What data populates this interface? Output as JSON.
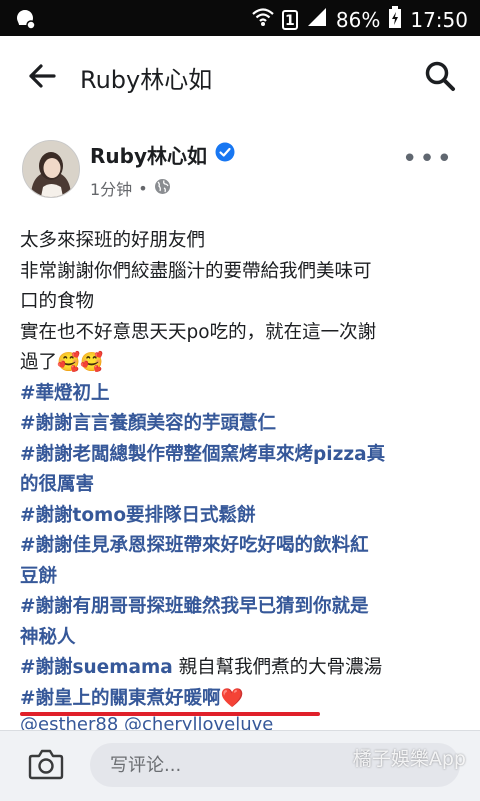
{
  "status_bar": {
    "battery": "86%",
    "time": "17:50",
    "sim_indicator": "1",
    "icons": [
      "notification-icon",
      "wifi-icon",
      "sim-icon",
      "signal-icon",
      "battery-icon"
    ]
  },
  "header": {
    "title": "Ruby林心如",
    "back_icon": "back-arrow-icon",
    "search_icon": "search-icon"
  },
  "post": {
    "author": "Ruby林心如",
    "verified_icon": "verified-badge-icon",
    "time": "1分钟",
    "separator": "•",
    "audience_icon": "globe-icon",
    "more_icon": "more-options-icon",
    "lines": [
      {
        "text": "太多來探班的好朋友們",
        "hashtag": false
      },
      {
        "text": "非常謝謝你們絞盡腦汁的要帶給我們美味可",
        "hashtag": false
      },
      {
        "text": "口的食物",
        "hashtag": false
      },
      {
        "text": "實在也不好意思天天po吃的，就在這一次謝",
        "hashtag": false
      },
      {
        "text": "過了🥰🥰",
        "hashtag": false
      },
      {
        "text": "#華燈初上",
        "hashtag": true
      },
      {
        "text": "#謝謝言言養顏美容的芋頭薏仁",
        "hashtag": true
      },
      {
        "text": "#謝謝老闆總製作帶整個窯烤車來烤pizza真",
        "hashtag": true
      },
      {
        "text": "的很厲害",
        "hashtag": true
      },
      {
        "text": "#謝謝tomo要排隊日式鬆餅",
        "hashtag": true
      },
      {
        "text": "#謝謝佳見承恩探班帶來好吃好喝的飲料紅",
        "hashtag": true
      },
      {
        "text": "豆餅",
        "hashtag": true
      },
      {
        "text": "#謝謝有朋哥哥探班雖然我早已猜到你就是",
        "hashtag": true
      },
      {
        "text": "神秘人",
        "hashtag": true
      }
    ],
    "suemama_tag": "#謝謝suemama",
    "suemama_text": " 親自幫我們煮的大骨濃湯",
    "last_tag": "#謝皇上的關東煮好暖啊❤️",
    "mentions": "@esther88 @cherylloveluve"
  },
  "comment_bar": {
    "camera_icon": "camera-icon",
    "placeholder": "写评论..."
  },
  "watermark": "橘子娛樂App"
}
